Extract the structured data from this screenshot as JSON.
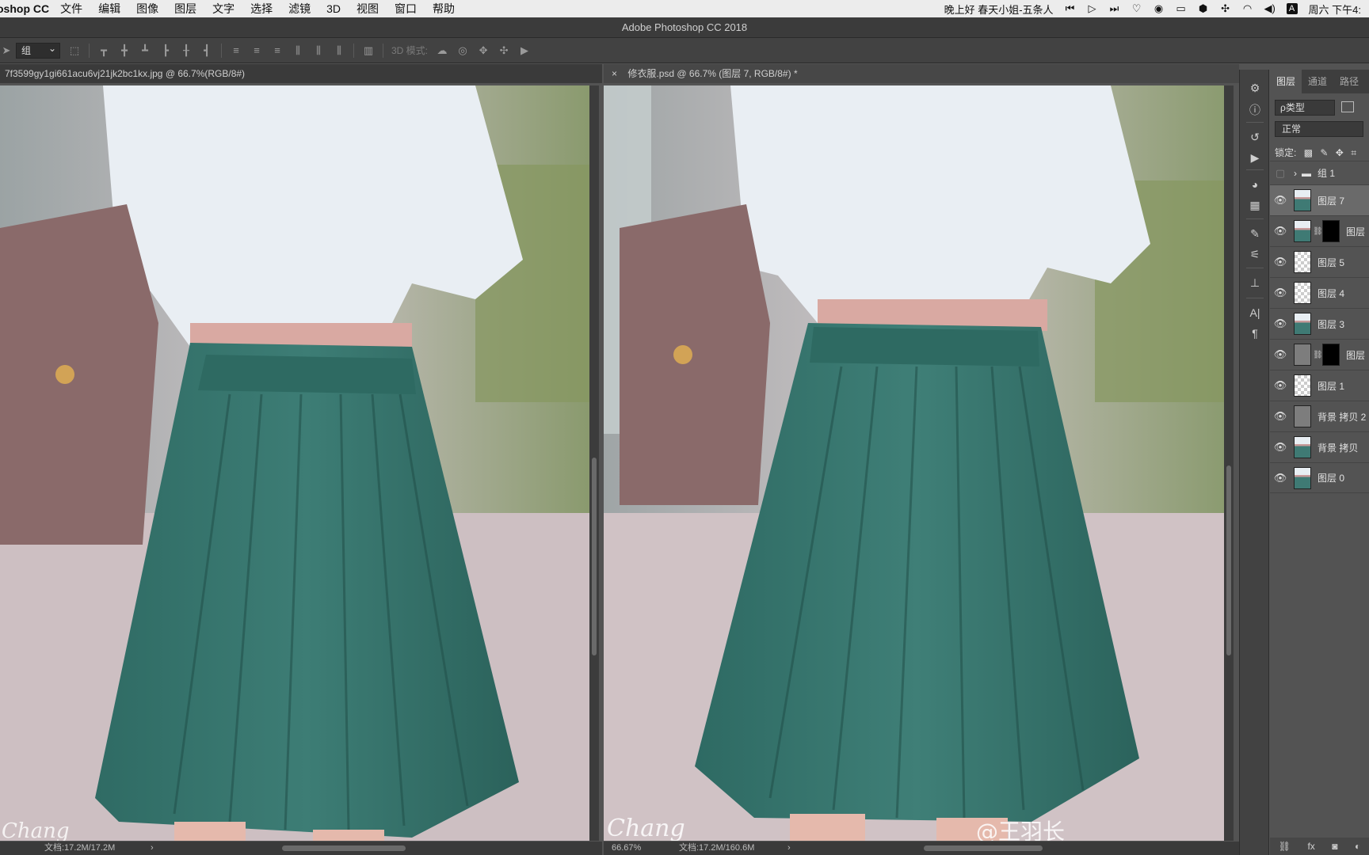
{
  "menubar": {
    "app": "oshop CC",
    "items": [
      "文件",
      "编辑",
      "图像",
      "图层",
      "文字",
      "选择",
      "滤镜",
      "3D",
      "视图",
      "窗口",
      "帮助"
    ],
    "now_playing": "晚上好 春天小姐-五条人",
    "clock": "周六 下午4:"
  },
  "window": {
    "title": "Adobe Photoshop CC 2018"
  },
  "options": {
    "select_value": "组",
    "mode_label": "3D 模式:"
  },
  "docs": {
    "left": {
      "tab_title": "7f3599gy1gi661acu6vj21jk2bc1kx.jpg @ 66.7%(RGB/8#)",
      "status": "文档:17.2M/17.2M",
      "arrow": "›"
    },
    "right": {
      "close": "×",
      "tab_title": "修衣服.psd @ 66.7% (图层 7, RGB/8#) *",
      "zoom": "66.67%",
      "status": "文档:17.2M/160.6M",
      "arrow": "›"
    }
  },
  "panel": {
    "tabs": [
      "图层",
      "通道",
      "路径"
    ],
    "filter": "ρ类型",
    "blend_mode": "正常",
    "lock_label": "锁定:",
    "layers": [
      {
        "name": "组 1",
        "kind": "group",
        "visible": false
      },
      {
        "name": "图层 7",
        "kind": "photo",
        "visible": true,
        "selected": true
      },
      {
        "name": "图层",
        "kind": "photo-mask",
        "visible": true
      },
      {
        "name": "图层 5",
        "kind": "checker",
        "visible": true
      },
      {
        "name": "图层 4",
        "kind": "checker",
        "visible": true
      },
      {
        "name": "图层 3",
        "kind": "photo",
        "visible": true
      },
      {
        "name": "图层",
        "kind": "gray-mask",
        "visible": true
      },
      {
        "name": "图层 1",
        "kind": "checker",
        "visible": true
      },
      {
        "name": "背景 拷贝 2",
        "kind": "gray",
        "visible": true
      },
      {
        "name": "背景 拷贝",
        "kind": "photo",
        "visible": true
      },
      {
        "name": "图层 0",
        "kind": "photo",
        "visible": true
      }
    ]
  },
  "canvas_text": {
    "watermark_left": "Chang",
    "watermark_right": "@王羽长"
  }
}
